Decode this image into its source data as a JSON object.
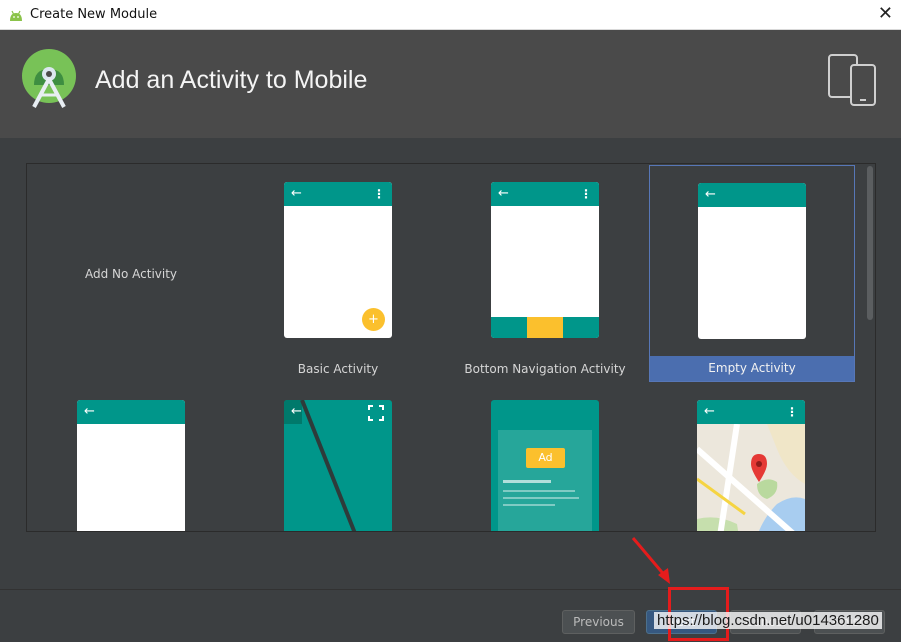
{
  "window": {
    "title": "Create New Module"
  },
  "header": {
    "heading": "Add an Activity to Mobile"
  },
  "templates": [
    {
      "label": "Add No Activity"
    },
    {
      "label": "Basic Activity"
    },
    {
      "label": "Bottom Navigation Activity"
    },
    {
      "label": "Empty Activity",
      "selected": true
    },
    {
      "label": ""
    },
    {
      "label": ""
    },
    {
      "label": "",
      "ad_label": "Ad"
    },
    {
      "label": ""
    }
  ],
  "buttons": {
    "previous": "Previous",
    "next": "Next",
    "cancel": "Cancel",
    "finish": "Finish"
  },
  "watermark": "https://blog.csdn.net/u014361280",
  "colors": {
    "accent_teal": "#00968a",
    "fab_yellow": "#fbc02d",
    "selection_blue": "#4b6eaf",
    "annotation_red": "#e51c1c"
  },
  "icons": [
    "android-icon",
    "close-icon",
    "android-studio-logo-icon",
    "devices-icon",
    "back-arrow-icon",
    "overflow-menu-icon",
    "add-icon",
    "fullscreen-icon",
    "map-pin-icon"
  ]
}
